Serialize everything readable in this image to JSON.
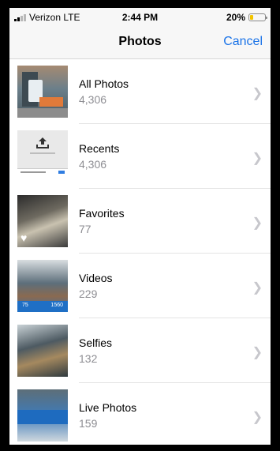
{
  "status_bar": {
    "carrier": "Verizon LTE",
    "time": "2:44 PM",
    "battery": "20%",
    "battery_level": 0.2
  },
  "nav": {
    "title": "Photos",
    "cancel_label": "Cancel"
  },
  "albums": [
    {
      "name": "All Photos",
      "count": "4,306"
    },
    {
      "name": "Recents",
      "count": "4,306"
    },
    {
      "name": "Favorites",
      "count": "77"
    },
    {
      "name": "Videos",
      "count": "229"
    },
    {
      "name": "Selfies",
      "count": "132"
    },
    {
      "name": "Live Photos",
      "count": "159"
    }
  ],
  "thumbnails": {
    "videos_left": "75",
    "videos_right": "1560"
  },
  "colors": {
    "accent": "#1a73e8",
    "battery": "#f2c400",
    "secondary_text": "#8e8e93"
  },
  "icons": {
    "chevron": "chevron-right-icon",
    "upload": "upload-icon",
    "heart": "heart-icon"
  }
}
